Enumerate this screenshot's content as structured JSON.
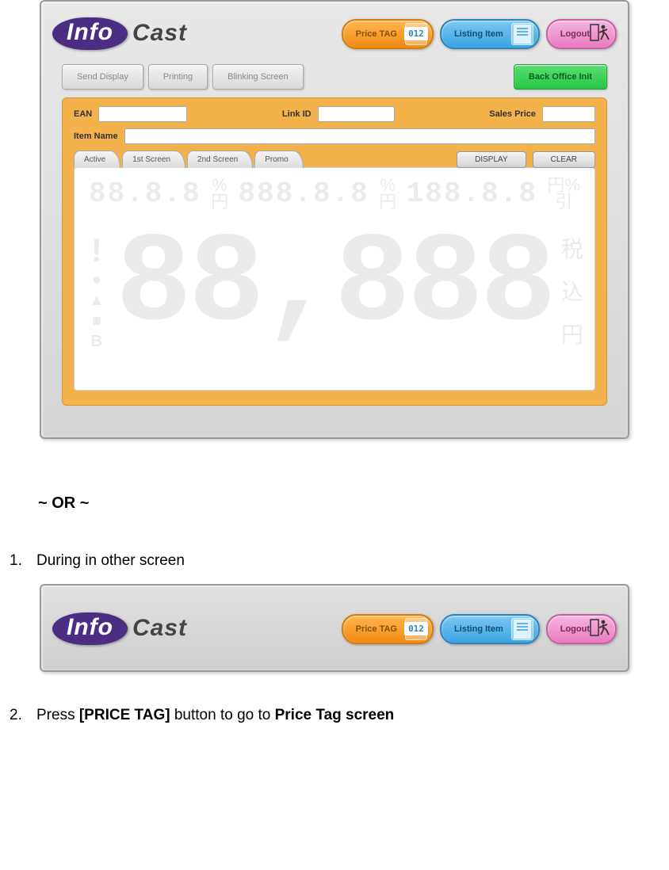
{
  "logo": {
    "info": "Info",
    "cast": "Cast"
  },
  "top_buttons": {
    "price_tag": {
      "label": "Price TAG",
      "badge": "012"
    },
    "listing_item": {
      "label": "Listing Item"
    },
    "logout": {
      "label": "Logout"
    }
  },
  "toolbar": {
    "send_display": "Send Display",
    "printing": "Printing",
    "blinking_screen": "Blinking Screen",
    "back_office": "Back Office Init"
  },
  "fields": {
    "ean": "EAN",
    "link_id": "Link ID",
    "sales_price": "Sales Price",
    "item_name": "Item Name"
  },
  "tabs": {
    "active": "Active",
    "first_screen": "1st Screen",
    "second_screen": "2nd Screen",
    "promo": "Promo"
  },
  "mini_buttons": {
    "display": "DISPLAY",
    "clear": "CLEAR"
  },
  "lcd": {
    "row_group1": "88.8.8",
    "sym1_top": "%",
    "sym1_bot": "円",
    "row_group2": "888.8.8",
    "row_group3": "188.8.8",
    "sym3_top": "円%",
    "sym3_bot": "引",
    "big": "88,888",
    "side_excl": "!",
    "side_circle": "●",
    "side_tri": "▲",
    "side_sq": "■",
    "side_b": "B",
    "yen1": "税",
    "yen2": "込",
    "yen3": "円"
  },
  "doc": {
    "or_text": "~ OR ~",
    "step1_num": "1.",
    "step1_text": "During in other screen",
    "step2_num": "2.",
    "step2_a": "Press ",
    "step2_b": "[PRICE TAG]",
    "step2_c": " button to go to ",
    "step2_d": "Price Tag screen"
  }
}
